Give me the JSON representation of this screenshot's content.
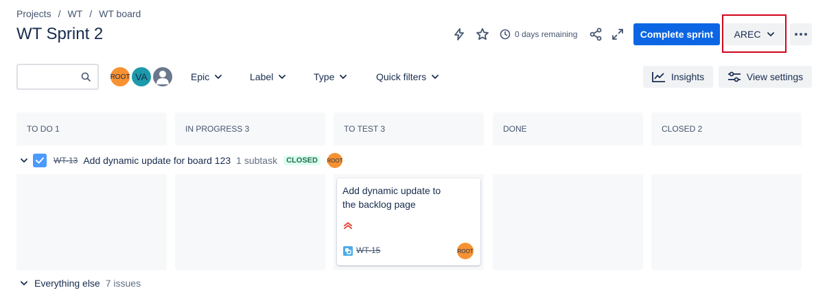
{
  "breadcrumb": [
    "Projects",
    "WT",
    "WT board"
  ],
  "page_title": "WT Sprint 2",
  "header": {
    "days_remaining": "0 days remaining",
    "complete_sprint_label": "Complete sprint",
    "group_by_value": "AREC"
  },
  "search": {
    "value": "",
    "placeholder": ""
  },
  "avatars": [
    "ROOT",
    "VA"
  ],
  "filters": {
    "epic": "Epic",
    "label": "Label",
    "type": "Type",
    "quick": "Quick filters"
  },
  "toolbar": {
    "insights": "Insights",
    "view_settings": "View settings"
  },
  "columns": [
    {
      "label": "TO DO 1"
    },
    {
      "label": "IN PROGRESS 3"
    },
    {
      "label": "TO TEST 3"
    },
    {
      "label": "DONE"
    },
    {
      "label": "CLOSED 2"
    }
  ],
  "swimlane": {
    "key": "WT-13",
    "title": "Add dynamic update for board 123",
    "subtasks": "1 subtask",
    "status": "CLOSED",
    "assignee": "ROOT"
  },
  "card": {
    "title": "Add dynamic update to the backlog page",
    "key": "WT-15",
    "assignee": "ROOT"
  },
  "everything_else": {
    "label": "Everything else",
    "count": "7 issues"
  },
  "colors": {
    "primary": "#0c66e4",
    "highlight": "#d0021b",
    "closed_lozenge_bg": "#dcfff1"
  }
}
